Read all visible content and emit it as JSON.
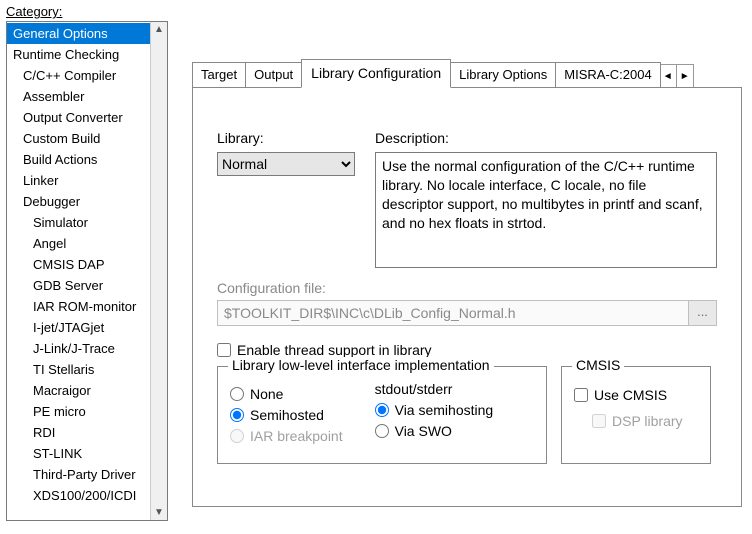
{
  "sidebar": {
    "label": "Category:",
    "items": [
      {
        "label": "General Options",
        "indent": 0,
        "selected": true
      },
      {
        "label": "Runtime Checking",
        "indent": 0
      },
      {
        "label": "C/C++ Compiler",
        "indent": 1
      },
      {
        "label": "Assembler",
        "indent": 1
      },
      {
        "label": "Output Converter",
        "indent": 1
      },
      {
        "label": "Custom Build",
        "indent": 1
      },
      {
        "label": "Build Actions",
        "indent": 1
      },
      {
        "label": "Linker",
        "indent": 1
      },
      {
        "label": "Debugger",
        "indent": 1
      },
      {
        "label": "Simulator",
        "indent": 2
      },
      {
        "label": "Angel",
        "indent": 2
      },
      {
        "label": "CMSIS DAP",
        "indent": 2
      },
      {
        "label": "GDB Server",
        "indent": 2
      },
      {
        "label": "IAR ROM-monitor",
        "indent": 2
      },
      {
        "label": "I-jet/JTAGjet",
        "indent": 2
      },
      {
        "label": "J-Link/J-Trace",
        "indent": 2
      },
      {
        "label": "TI Stellaris",
        "indent": 2
      },
      {
        "label": "Macraigor",
        "indent": 2
      },
      {
        "label": "PE micro",
        "indent": 2
      },
      {
        "label": "RDI",
        "indent": 2
      },
      {
        "label": "ST-LINK",
        "indent": 2
      },
      {
        "label": "Third-Party Driver",
        "indent": 2
      },
      {
        "label": "XDS100/200/ICDI",
        "indent": 2
      }
    ]
  },
  "tabs": {
    "items": [
      "Target",
      "Output",
      "Library Configuration",
      "Library Options",
      "MISRA-C:2004"
    ],
    "active_index": 2
  },
  "library": {
    "label": "Library:",
    "selected": "Normal"
  },
  "description": {
    "label": "Description:",
    "text": "Use the normal configuration of the C/C++ runtime library. No locale interface, C locale, no file descriptor support, no multibytes in printf and scanf, and no hex floats in strtod."
  },
  "config_file": {
    "label": "Configuration file:",
    "value": "$TOOLKIT_DIR$\\INC\\c\\DLib_Config_Normal.h",
    "browse": "..."
  },
  "thread_support": {
    "label": "Enable thread support in library",
    "checked": false
  },
  "lowlevel": {
    "legend": "Library low-level interface implementation",
    "left": {
      "none": "None",
      "semihosted": "Semihosted",
      "iar_bp": "IAR breakpoint"
    },
    "right": {
      "header": "stdout/stderr",
      "via_semi": "Via semihosting",
      "via_swo": "Via SWO"
    }
  },
  "cmsis": {
    "legend": "CMSIS",
    "use": "Use CMSIS",
    "dsp": "DSP library"
  }
}
